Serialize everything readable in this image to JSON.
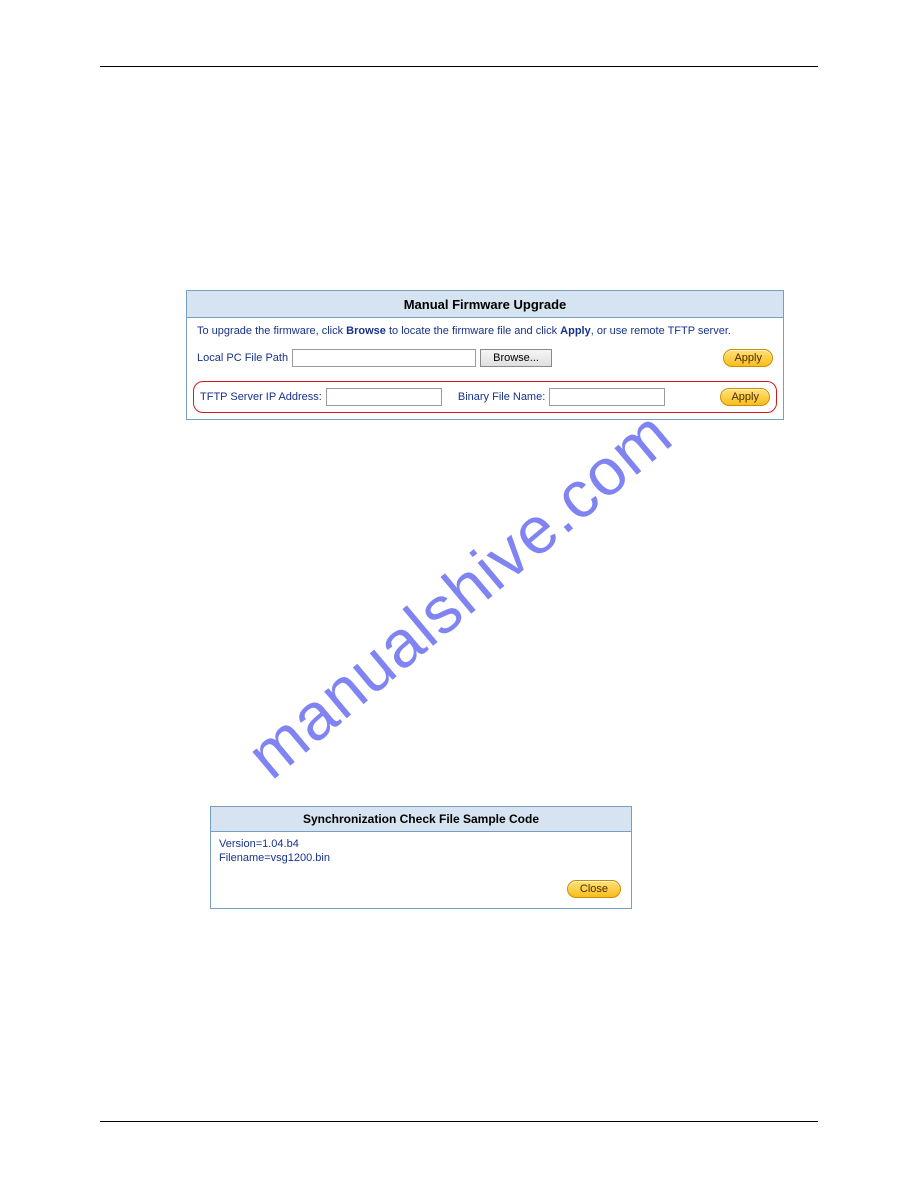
{
  "watermark": "manualshive.com",
  "panel1": {
    "title": "Manual Firmware Upgrade",
    "instr_parts": {
      "p1": "To upgrade the firmware, click ",
      "b1": "Browse",
      "p2": " to locate the firmware file and click ",
      "b2": "Apply",
      "p3": ", or use remote TFTP server."
    },
    "local_label": "Local PC File Path",
    "browse_label": "Browse...",
    "apply_label": "Apply",
    "tftp_ip_label": "TFTP Server IP Address:",
    "binary_label": "Binary File Name:",
    "apply_label2": "Apply",
    "local_value": "",
    "tftp_ip_value": "",
    "binary_value": ""
  },
  "panel2": {
    "title": "Synchronization Check File Sample Code",
    "line1": "Version=1.04.b4",
    "line2": "Filename=vsg1200.bin",
    "close_label": "Close"
  }
}
